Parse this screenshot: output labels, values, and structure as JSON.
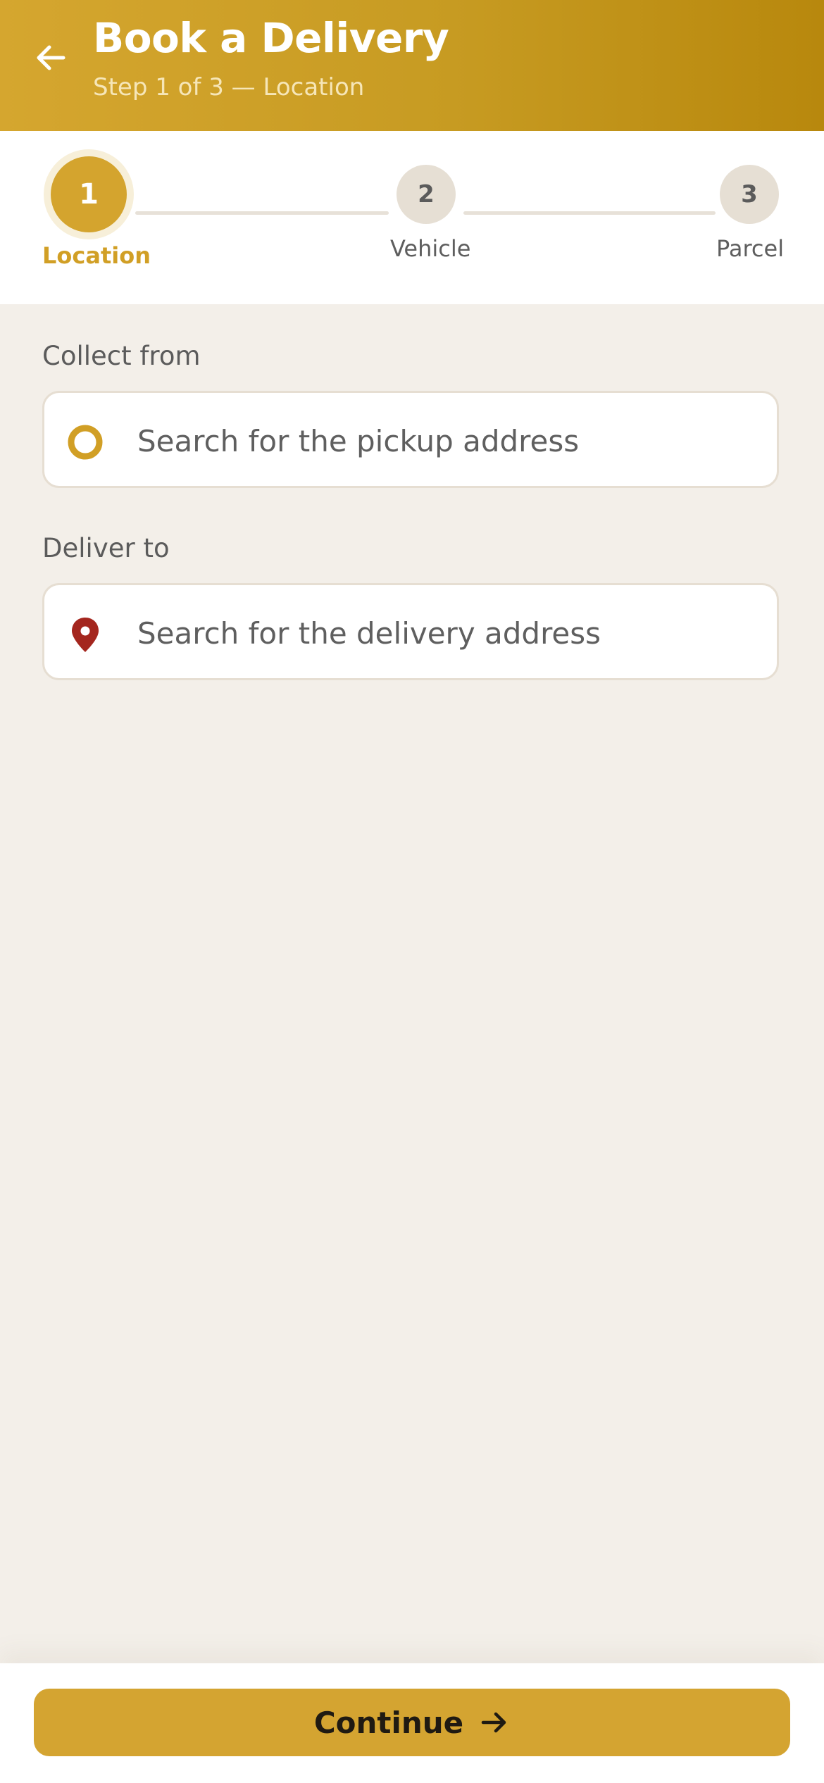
{
  "header": {
    "title": "Book a Delivery",
    "subtitle": "Step 1 of 3 — Location",
    "background_color": "#c79b22",
    "back_icon": "arrow-left-icon"
  },
  "stepper": {
    "accent_color": "#d4a42e",
    "steps": [
      {
        "number": "1",
        "label": "Location",
        "state": "active"
      },
      {
        "number": "2",
        "label": "Vehicle",
        "state": "inactive"
      },
      {
        "number": "3",
        "label": "Parcel",
        "state": "inactive"
      }
    ]
  },
  "form": {
    "pickup": {
      "label": "Collect from",
      "placeholder": "Search for the pickup address",
      "icon": "pickup-ring-icon",
      "value": ""
    },
    "delivery": {
      "label": "Deliver to",
      "placeholder": "Search for the delivery address",
      "icon": "map-pin-icon",
      "icon_color": "#a4261e",
      "value": ""
    }
  },
  "footer": {
    "continue_label": "Continue",
    "continue_icon": "arrow-right-icon",
    "button_color": "#d4a431"
  }
}
